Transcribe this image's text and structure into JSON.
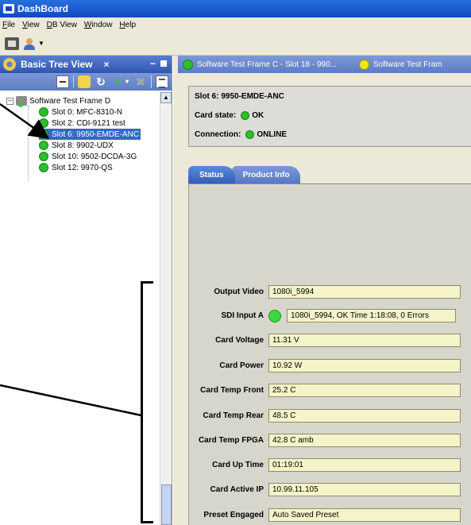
{
  "window": {
    "title": "DashBoard"
  },
  "menu": [
    "File",
    "View",
    "DB View",
    "Window",
    "Help"
  ],
  "toolbar": {
    "frame_icon": "frame-icon",
    "user_icon": "user-icon"
  },
  "left_panel": {
    "title": "Basic Tree View",
    "close_glyph": "×",
    "root": {
      "label": "Software Test Frame D",
      "expander": "−"
    },
    "slots": [
      {
        "label": "Slot 0: MFC-8310-N",
        "status_color": "#2dbd2d",
        "selected": false
      },
      {
        "label": "Slot 2: CDI-9121 test",
        "status_color": "#2dbd2d",
        "selected": false
      },
      {
        "label": "Slot 6: 9950-EMDE-ANC",
        "status_color": "#2dbd2d",
        "selected": true
      },
      {
        "label": "Slot 8: 9902-UDX",
        "status_color": "#2dbd2d",
        "selected": false
      },
      {
        "label": "Slot 10: 9502-DCDA-3G",
        "status_color": "#2dbd2d",
        "selected": false
      },
      {
        "label": "Slot 12: 9970-QS",
        "status_color": "#2dbd2d",
        "selected": false
      }
    ]
  },
  "open_tabs": [
    {
      "label": "Software Test Frame C - Slot 18 - 990...",
      "status_color": "#2dbd2d"
    },
    {
      "label": "Software Test Fram",
      "status_color": "#ede61a"
    }
  ],
  "card_info": {
    "slot": "Slot 6: 9950-EMDE-ANC",
    "card_state_label": "Card state:",
    "card_state_value": "OK",
    "connection_label": "Connection:",
    "connection_value": "ONLINE"
  },
  "tabs": [
    {
      "label": "Status",
      "active": true
    },
    {
      "label": "Product Info",
      "active": false
    }
  ],
  "status_fields": [
    {
      "label": "Output Video",
      "value": "1080i_5994"
    },
    {
      "label": "SDI Input A",
      "value": "1080i_5994, OK Time 1:18:08, 0 Errors"
    },
    {
      "label": "Card Voltage",
      "value": "11.31 V"
    },
    {
      "label": "Card Power",
      "value": "10.92 W"
    },
    {
      "label": "Card Temp Front",
      "value": "25.2 C"
    },
    {
      "label": "Card Temp Rear",
      "value": "48.5 C"
    },
    {
      "label": "Card Temp FPGA",
      "value": "42.8 C amb"
    },
    {
      "label": "Card Up Time",
      "value": "01:19:01"
    },
    {
      "label": "Card Active IP",
      "value": "10.99.11.105"
    },
    {
      "label": "Preset Engaged",
      "value": "Auto Saved Preset"
    }
  ],
  "colors": {
    "title_bar": "#1048c0",
    "selection": "#316ac5",
    "field_bg": "#f5f3c8",
    "status_ok": "#2dbd2d"
  }
}
